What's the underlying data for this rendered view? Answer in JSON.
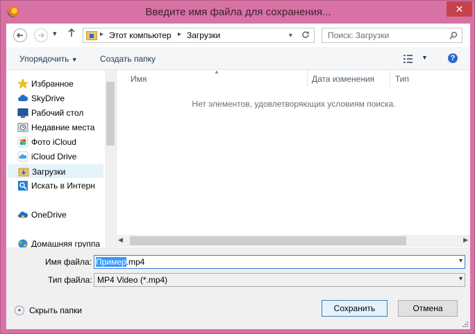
{
  "window": {
    "title": "Введите имя файла для сохранения...",
    "close_glyph": "✕"
  },
  "address": {
    "breadcrumbs": [
      "Этот компьютер",
      "Загрузки"
    ],
    "search_placeholder": "Поиск: Загрузки"
  },
  "toolbar": {
    "organize_label": "Упорядочить",
    "new_folder_label": "Создать папку"
  },
  "nav": {
    "items": [
      {
        "label": "Избранное",
        "icon": "star-icon"
      },
      {
        "label": "SkyDrive",
        "icon": "cloud-icon"
      },
      {
        "label": "Рабочий стол",
        "icon": "desktop-icon"
      },
      {
        "label": "Недавние места",
        "icon": "recent-places-icon"
      },
      {
        "label": "Фото iCloud",
        "icon": "photos-icon"
      },
      {
        "label": "iCloud Drive",
        "icon": "icloud-icon"
      },
      {
        "label": "Загрузки",
        "icon": "downloads-folder-icon",
        "selected": true
      },
      {
        "label": "Искать в Интерн",
        "icon": "search-web-icon"
      },
      {
        "label": "OneDrive",
        "icon": "onedrive-icon"
      },
      {
        "label": "Домашняя группа",
        "icon": "homegroup-icon"
      }
    ]
  },
  "list": {
    "columns": [
      "Имя",
      "Дата изменения",
      "Тип"
    ],
    "empty_message": "Нет элементов, удовлетворяющих условиям поиска."
  },
  "form": {
    "filename_label": "Имя файла:",
    "filename_selected": "Пример",
    "filename_rest": ".mp4",
    "filetype_label": "Тип файла:",
    "filetype_value": "MP4 Video (*.mp4)"
  },
  "footer": {
    "hide_folders_label": "Скрыть папки",
    "save_label": "Сохранить",
    "cancel_label": "Отмена"
  },
  "colors": {
    "frame": "#d872a4",
    "close": "#c7414b",
    "selection": "#3399ff"
  }
}
